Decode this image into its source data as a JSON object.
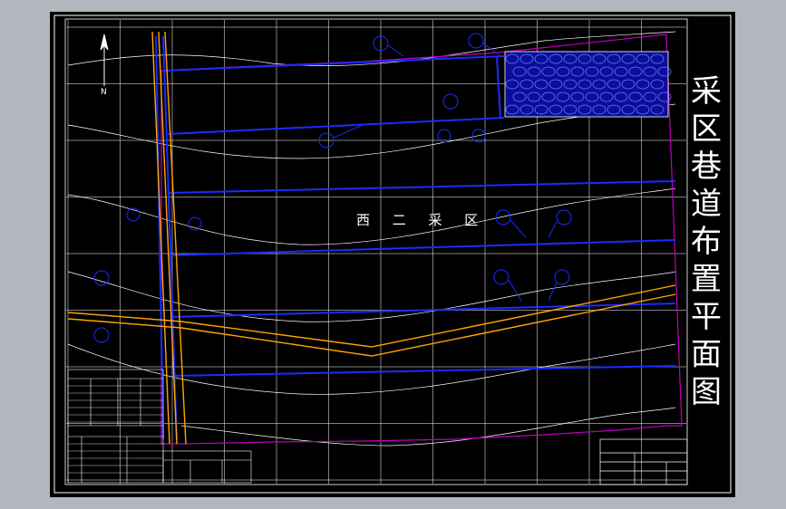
{
  "drawing": {
    "title_chars": [
      "采",
      "区",
      "巷",
      "道",
      "布",
      "置",
      "平",
      "面",
      "图"
    ],
    "mining_area_label": "西 二 采 区",
    "north_arrow_letter": "N"
  },
  "colors": {
    "viewport_bg": "#b3b8c0",
    "paper_bg": "#000000",
    "frame": "#ffffff",
    "roadway_blue": "#1a2cff",
    "boundary_magenta": "#c000c0",
    "conveyor_orange": "#ffa500",
    "contour_white": "#ffffff",
    "rock_fill": "#1010d0"
  }
}
